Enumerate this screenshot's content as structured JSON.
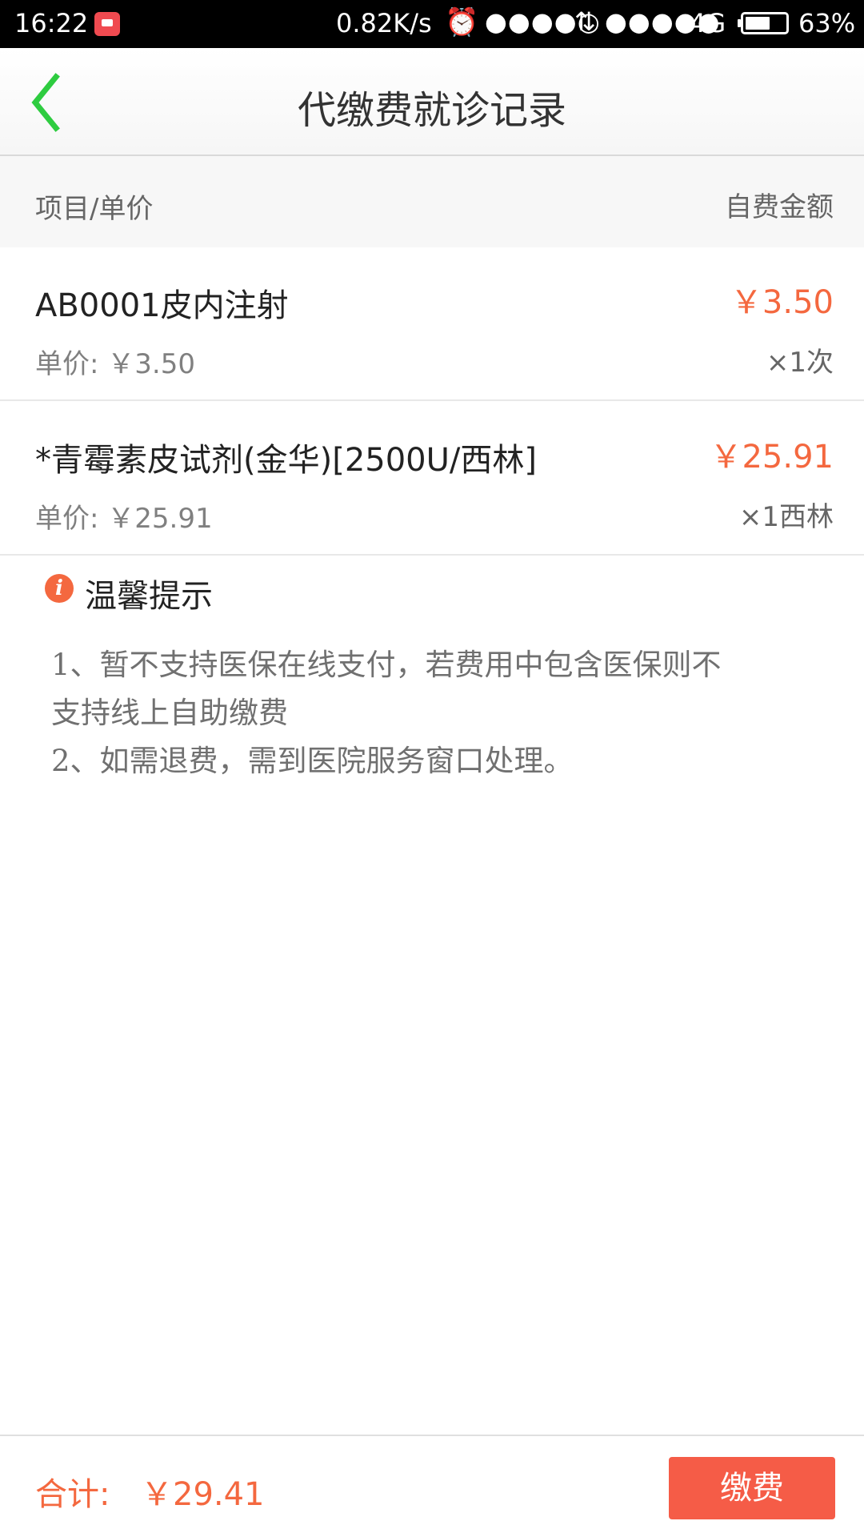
{
  "status_bar": {
    "time": "16:22",
    "net_speed": "0.82K/s",
    "signal_1": "●●●●○",
    "signal_2": "●●●●●",
    "network_type": "4G",
    "battery_percent": "63%",
    "battery_level": 0.63
  },
  "header": {
    "title": "代缴费就诊记录"
  },
  "table_header": {
    "left_label": "项目/单价",
    "right_label": "自费金额"
  },
  "items": [
    {
      "name": "AB0001皮内注射",
      "amount": "￥3.50",
      "unit_price": "单价: ￥3.50",
      "quantity": "×1次"
    },
    {
      "name": "*青霉素皮试剂(金华)[2500U/西林]",
      "amount": "￥25.91",
      "unit_price": "单价: ￥25.91",
      "quantity": "×1西林"
    }
  ],
  "tips": {
    "title": "温馨提示",
    "lines": [
      "1、暂不支持医保在线支付，若费用中包含医保则不",
      "支持线上自助缴费",
      "2、如需退费，需到医院服务窗口处理。"
    ]
  },
  "footer": {
    "total_label": "合计:",
    "total_amount": "￥29.41",
    "pay_button_label": "缴费"
  },
  "colors": {
    "accent_green": "#2ecc40",
    "price_orange": "#f4683f",
    "pay_button": "#f55c47"
  },
  "icons": {
    "back": "chevron-left-icon",
    "info": "info-icon",
    "alarm": "alarm-clock-icon",
    "message": "message-icon"
  }
}
